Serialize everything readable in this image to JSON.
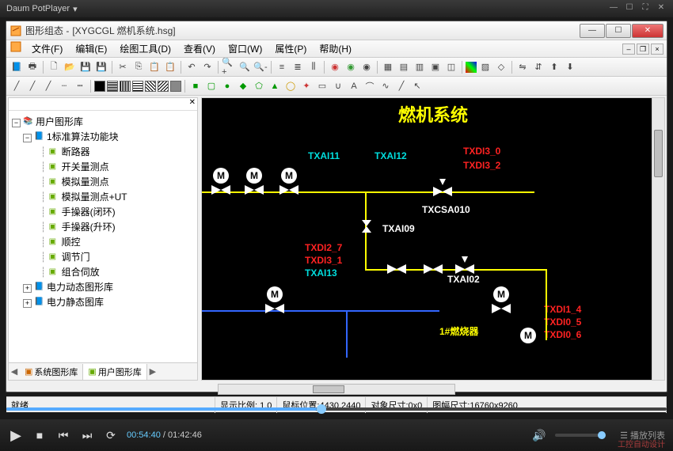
{
  "player": {
    "title": "Daum PotPlayer",
    "time_current": "00:54:40",
    "time_total": "01:42:46",
    "playlist_label": "播放列表",
    "watermark": "工控自动设计"
  },
  "app": {
    "title_prefix": "图形组态 - ",
    "doc_name": "[XYGCGL 燃机系统.hsg]"
  },
  "menu": {
    "file": "文件(F)",
    "edit": "编辑(E)",
    "tools": "绘图工具(D)",
    "view": "查看(V)",
    "window": "窗口(W)",
    "attr": "属性(P)",
    "help": "帮助(H)"
  },
  "tree": {
    "root": "用户图形库",
    "g1": "1标准算法功能块",
    "items": [
      "断路器",
      "开关量测点",
      "模拟量测点",
      "模拟量测点+UT",
      "手操器(闭环)",
      "手操器(升环)",
      "顺控",
      "调节门",
      "组合伺放"
    ],
    "g2": "电力动态图形库",
    "g3": "电力静态图库",
    "tab1": "系统图形库",
    "tab2": "用户图形库"
  },
  "canvas": {
    "title": "燃机系统",
    "labels": {
      "txai11": "TXAI11",
      "txai12": "TXAI12",
      "txdi3_0": "TXDI3_0",
      "txdi3_2": "TXDI3_2",
      "txcsa010": "TXCSA010",
      "txai09": "TXAI09",
      "txdi2_7": "TXDI2_7",
      "txdi3_1": "TXDI3_1",
      "txai13": "TXAI13",
      "txai02": "TXAI02",
      "burner1": "1#燃烧器",
      "txdi1_4": "TXDI1_4",
      "txdi0_5": "TXDI0_5",
      "txdi0_6": "TXDI0_6"
    },
    "m": "M"
  },
  "status": {
    "ready": "就绪",
    "zoom_label": "显示比例:",
    "zoom_val": " 1.0",
    "mouse_label": "鼠标位置:",
    "mouse_val": "4430,2440",
    "obj_label": "对象尺寸:",
    "obj_val": "0x0",
    "sheet_label": "图幅尺寸:",
    "sheet_val": "16760x9260"
  }
}
